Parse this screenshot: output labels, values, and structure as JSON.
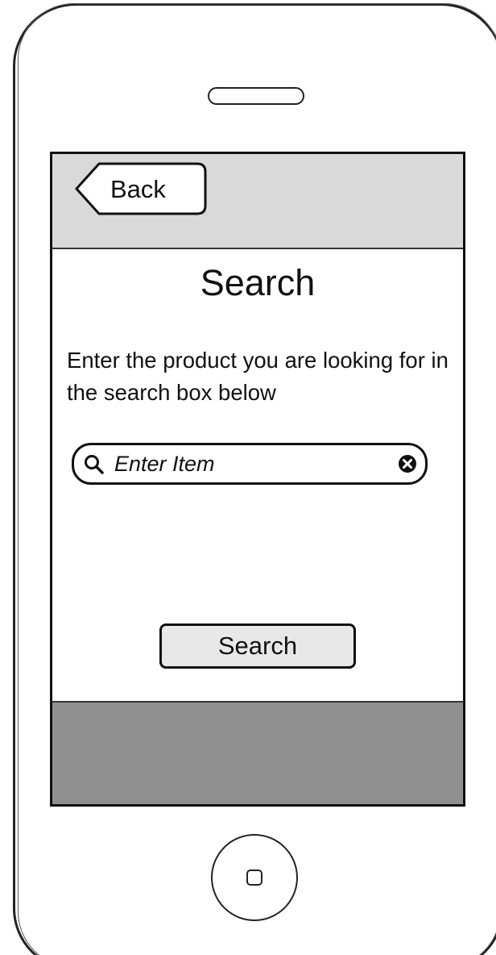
{
  "nav": {
    "back_label": "Back"
  },
  "page": {
    "title": "Search",
    "instructions": "Enter the product you are looking for in the search box below"
  },
  "search": {
    "placeholder": "Enter Item",
    "icon": "search-icon",
    "clear_icon": "clear-icon"
  },
  "actions": {
    "search_label": "Search"
  },
  "colors": {
    "nav_bar": "#d9d9d9",
    "footer_bar": "#909090",
    "button_fill": "#e8e8e8",
    "outline": "#111111"
  }
}
